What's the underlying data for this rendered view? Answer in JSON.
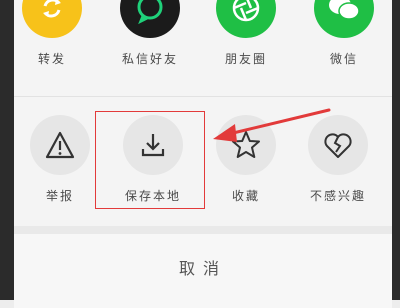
{
  "share_row": [
    {
      "label": "转发",
      "icon": "refresh-arrows-icon",
      "color": "#f7c21a"
    },
    {
      "label": "私信好友",
      "icon": "chat-bubble-icon",
      "color": "#1b1b1b"
    },
    {
      "label": "朋友圈",
      "icon": "camera-shutter-icon",
      "color": "#1fbf45"
    },
    {
      "label": "微信",
      "icon": "wechat-icon",
      "color": "#1fbf45"
    }
  ],
  "action_row": [
    {
      "label": "举报",
      "icon": "warning-triangle-icon"
    },
    {
      "label": "保存本地",
      "icon": "download-icon"
    },
    {
      "label": "收藏",
      "icon": "star-icon"
    },
    {
      "label": "不感兴趣",
      "icon": "broken-heart-icon"
    }
  ],
  "cancel_label": "取消",
  "annotation": {
    "highlight_color": "#e23a3a",
    "arrow_color": "#e23a3a"
  }
}
